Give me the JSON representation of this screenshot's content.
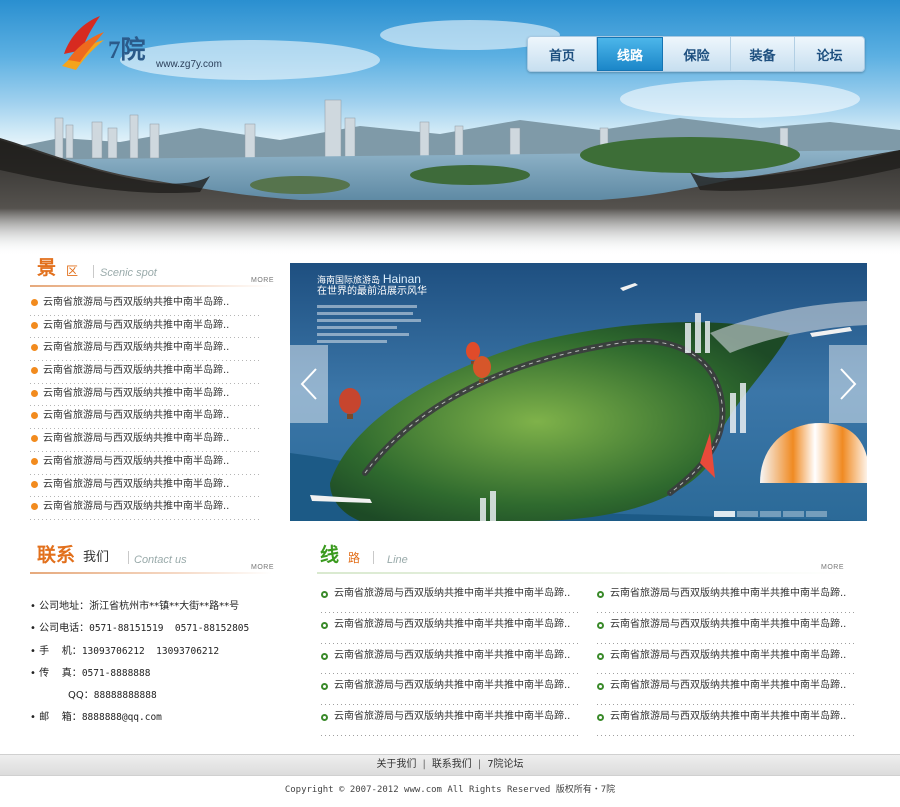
{
  "header": {
    "logo_text": "7院",
    "logo_url": "www.zg7y.com",
    "nav": [
      {
        "label": "首页",
        "active": false
      },
      {
        "label": "线路",
        "active": true
      },
      {
        "label": "保险",
        "active": false
      },
      {
        "label": "装备",
        "active": false
      },
      {
        "label": "论坛",
        "active": false
      }
    ]
  },
  "scenic": {
    "title_big": "景",
    "title_small": "区",
    "title_en": "Scenic spot",
    "more": "MORE",
    "items": [
      "云南省旅游局与西双版纳共推中南半岛蹄..",
      "云南省旅游局与西双版纳共推中南半岛蹄..",
      "云南省旅游局与西双版纳共推中南半岛蹄..",
      "云南省旅游局与西双版纳共推中南半岛蹄..",
      "云南省旅游局与西双版纳共推中南半岛蹄..",
      "云南省旅游局与西双版纳共推中南半岛蹄..",
      "云南省旅游局与西双版纳共推中南半岛蹄..",
      "云南省旅游局与西双版纳共推中南半岛蹄..",
      "云南省旅游局与西双版纳共推中南半岛蹄..",
      "云南省旅游局与西双版纳共推中南半岛蹄.."
    ]
  },
  "slider": {
    "headline_cn": "海南国际旅游岛",
    "headline_en": "Hainan",
    "subline": "在世界的最前沿展示风华",
    "slide_count": 5,
    "active_index": 0
  },
  "contact": {
    "title_big": "联系",
    "title_small": "我们",
    "title_en": "Contact us",
    "more": "MORE",
    "rows": [
      {
        "bullet": "•",
        "label": "公司地址：",
        "value": "浙江省杭州市**镇**大街**路**号"
      },
      {
        "bullet": "•",
        "label": "公司电话：",
        "value": "0571-88151519  0571-88152805"
      },
      {
        "bullet": "•",
        "label": "手    机：",
        "value": "13093706212  13093706212"
      },
      {
        "bullet": "•",
        "label": "传    真：",
        "value": "0571-8888888"
      },
      {
        "bullet": "",
        "label": "QQ：",
        "value": "88888888888"
      },
      {
        "bullet": "•",
        "label": "邮    箱：",
        "value": "8888888@qq.com"
      }
    ]
  },
  "routes": {
    "title_big": "线",
    "title_small": "路",
    "title_en": "Line",
    "more": "MORE",
    "left": [
      "云南省旅游局与西双版纳共推中南半共推中南半岛蹄..",
      "云南省旅游局与西双版纳共推中南半共推中南半岛蹄..",
      "云南省旅游局与西双版纳共推中南半共推中南半岛蹄..",
      "云南省旅游局与西双版纳共推中南半共推中南半岛蹄..",
      "云南省旅游局与西双版纳共推中南半共推中南半岛蹄.."
    ],
    "right": [
      "云南省旅游局与西双版纳共推中南半共推中南半岛蹄..",
      "云南省旅游局与西双版纳共推中南半共推中南半岛蹄..",
      "云南省旅游局与西双版纳共推中南半共推中南半岛蹄..",
      "云南省旅游局与西双版纳共推中南半共推中南半岛蹄..",
      "云南省旅游局与西双版纳共推中南半共推中南半岛蹄.."
    ]
  },
  "footer": {
    "links": [
      "关于我们",
      "联系我们",
      "7院论坛"
    ],
    "separator": "|",
    "copyright": "Copyright © 2007-2012 www.com All Rights Reserved 版权所有・7院"
  },
  "colors": {
    "accent_orange": "#e2701c",
    "accent_green": "#3a9a1e",
    "nav_active": "#1b86c8"
  }
}
